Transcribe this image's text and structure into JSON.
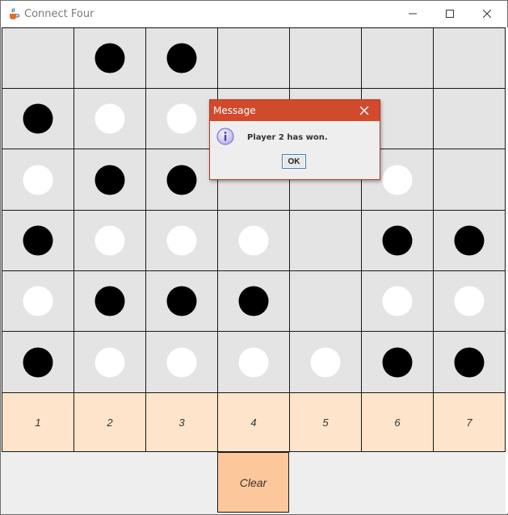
{
  "window": {
    "title": "Connect Four",
    "controls": [
      "minimize",
      "maximize",
      "close"
    ]
  },
  "board": {
    "columns": 7,
    "rows": 6,
    "grid": [
      [
        "empty",
        "black",
        "black",
        "empty",
        "empty",
        "empty",
        "empty"
      ],
      [
        "black",
        "white",
        "white",
        "empty",
        "empty",
        "empty",
        "empty"
      ],
      [
        "white",
        "black",
        "black",
        "empty",
        "empty",
        "white",
        "empty"
      ],
      [
        "black",
        "white",
        "white",
        "white",
        "empty",
        "black",
        "black"
      ],
      [
        "white",
        "black",
        "black",
        "black",
        "empty",
        "white",
        "white"
      ],
      [
        "black",
        "white",
        "white",
        "white",
        "white",
        "black",
        "black"
      ]
    ]
  },
  "column_buttons": [
    "1",
    "2",
    "3",
    "4",
    "5",
    "6",
    "7"
  ],
  "clear_button": "Clear",
  "dialog": {
    "title": "Message",
    "message": "Player 2 has won.",
    "ok_label": "OK",
    "icon": "info-icon"
  },
  "colors": {
    "cell_bg": "#e4e4e4",
    "column_button_bg": "#fde4cb",
    "clear_button_bg": "#fcc89b",
    "dialog_titlebar": "#d14a2c"
  }
}
